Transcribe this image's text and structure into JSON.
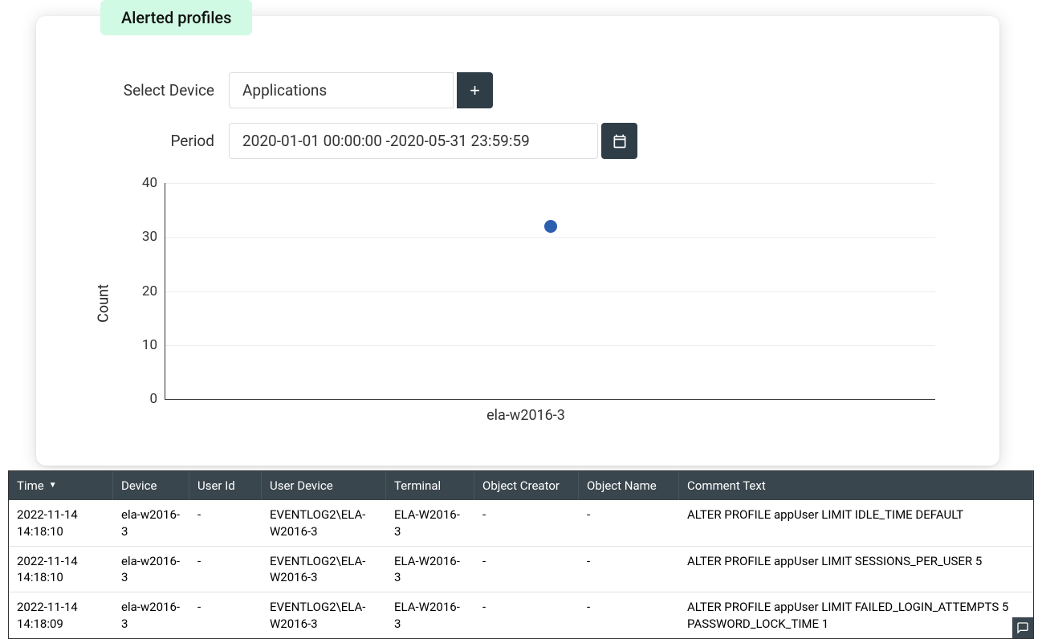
{
  "badge": "Alerted profiles",
  "filters": {
    "device_label": "Select Device",
    "device_value": "Applications",
    "period_label": "Period",
    "period_value": "2020-01-01 00:00:00 -2020-05-31 23:59:59"
  },
  "chart_data": {
    "type": "scatter",
    "ylabel": "Count",
    "ylim": [
      0,
      40
    ],
    "yticks": [
      0,
      10,
      20,
      30,
      40
    ],
    "categories": [
      "ela-w2016-3"
    ],
    "values": [
      32
    ]
  },
  "table": {
    "columns": [
      "Time",
      "Device",
      "User Id",
      "User Device",
      "Terminal",
      "Object Creator",
      "Object Name",
      "Comment Text"
    ],
    "rows": [
      {
        "time": "2022-11-14 14:18:10",
        "device": "ela-w2016-3",
        "userid": "-",
        "userdev": "EVENTLOG2\\ELA-W2016-3",
        "terminal": "ELA-W2016-3",
        "objcre": "-",
        "objname": "-",
        "comment": "ALTER PROFILE appUser LIMIT IDLE_TIME DEFAULT"
      },
      {
        "time": "2022-11-14 14:18:10",
        "device": "ela-w2016-3",
        "userid": "-",
        "userdev": "EVENTLOG2\\ELA-W2016-3",
        "terminal": "ELA-W2016-3",
        "objcre": "-",
        "objname": "-",
        "comment": "ALTER PROFILE appUser LIMIT SESSIONS_PER_USER 5"
      },
      {
        "time": "2022-11-14 14:18:09",
        "device": "ela-w2016-3",
        "userid": "-",
        "userdev": "EVENTLOG2\\ELA-W2016-3",
        "terminal": "ELA-W2016-3",
        "objcre": "-",
        "objname": "-",
        "comment": "ALTER PROFILE appUser LIMIT FAILED_LOGIN_ATTEMPTS 5 PASSWORD_LOCK_TIME 1"
      }
    ]
  }
}
